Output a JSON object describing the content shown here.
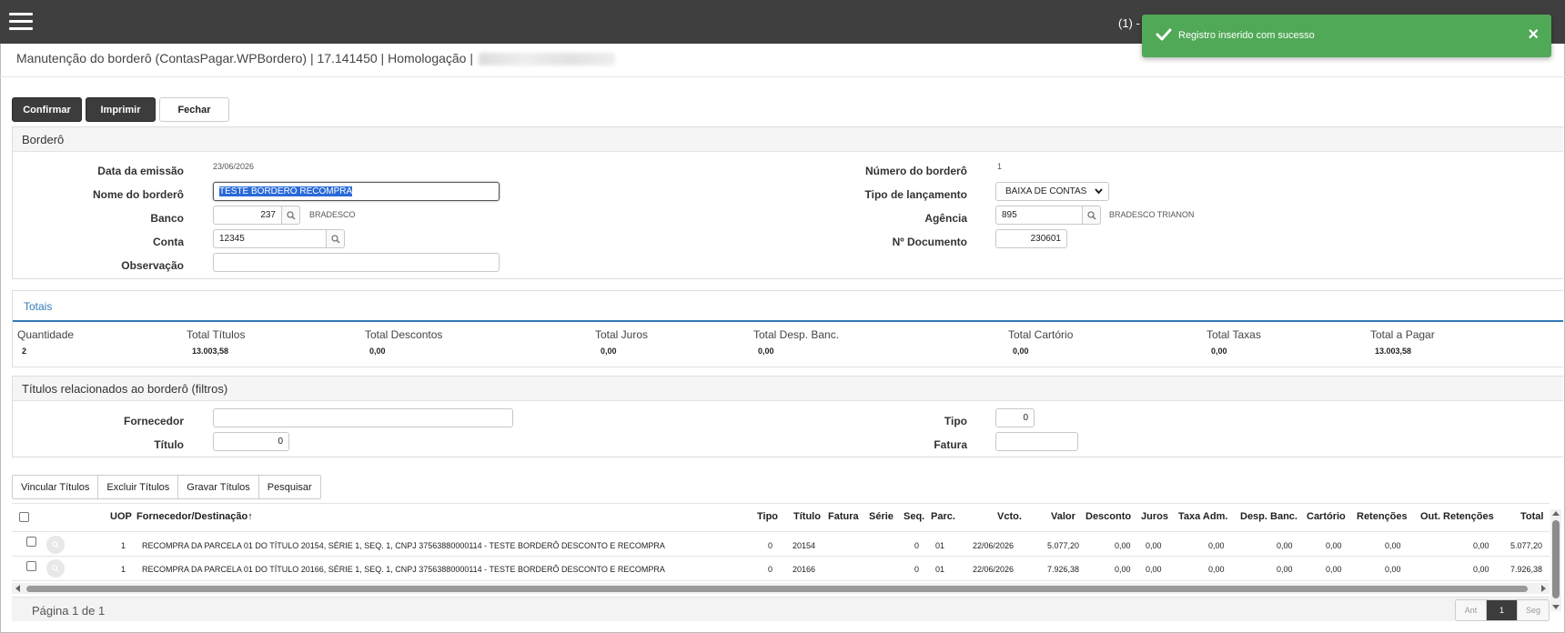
{
  "topbar": {
    "counter": "(1) -"
  },
  "toast": {
    "message": "Registro inserido com sucesso",
    "close": "×"
  },
  "page_title": "Manutenção do borderô (ContasPagar.WPBordero) | 17.141450 | Homologação | ",
  "toolbar": {
    "confirm": "Confirmar",
    "print": "Imprimir",
    "close": "Fechar"
  },
  "bordero": {
    "header": "Borderô",
    "data_emissao_label": "Data da emissão",
    "data_emissao": "23/06/2026",
    "nome_label": "Nome do borderô",
    "nome": "TESTE BORDERÔ RECOMPRA",
    "banco_label": "Banco",
    "banco": "237",
    "banco_nome": "BRADESCO",
    "conta_label": "Conta",
    "conta": "12345",
    "observacao_label": "Observação",
    "observacao": "",
    "numero_label": "Número do borderô",
    "numero": "1",
    "tipo_lanc_label": "Tipo de lançamento",
    "tipo_lanc": "BAIXA DE CONTAS",
    "agencia_label": "Agência",
    "agencia": "895",
    "agencia_nome": "BRADESCO TRIANON",
    "documento_label": "Nº Documento",
    "documento": "230601"
  },
  "totais": {
    "header": "Totais",
    "items": [
      {
        "label": "Quantidade",
        "value": "2"
      },
      {
        "label": "Total Títulos",
        "value": "13.003,58"
      },
      {
        "label": "Total Descontos",
        "value": "0,00"
      },
      {
        "label": "Total Juros",
        "value": "0,00"
      },
      {
        "label": "Total Desp. Banc.",
        "value": "0,00"
      },
      {
        "label": "Total Cartório",
        "value": "0,00"
      },
      {
        "label": "Total Taxas",
        "value": "0,00"
      },
      {
        "label": "Total a Pagar",
        "value": "13.003,58"
      }
    ]
  },
  "filtros": {
    "header": "Títulos relacionados ao borderô (filtros)",
    "fornecedor_label": "Fornecedor",
    "fornecedor": "",
    "titulo_label": "Título",
    "titulo": "0",
    "tipo_label": "Tipo",
    "tipo": "0",
    "fatura_label": "Fatura",
    "fatura": ""
  },
  "actions": {
    "vincular": "Vincular Títulos",
    "excluir": "Excluir Títulos",
    "gravar": "Gravar Títulos",
    "pesquisar": "Pesquisar"
  },
  "grid": {
    "columns": [
      "UOP",
      "Fornecedor/Destinação",
      "Tipo",
      "Título",
      "Fatura",
      "Série",
      "Seq.",
      "Parc.",
      "Vcto.",
      "Valor",
      "Desconto",
      "Juros",
      "Taxa Adm.",
      "Desp. Banc.",
      "Cartório",
      "Retenções",
      "Out. Retenções",
      "Total"
    ],
    "sort_indicator": "↑",
    "rows": [
      {
        "uop": "1",
        "fornecedor": "RECOMPRA DA PARCELA 01 DO TÍTULO 20154, SÉRIE 1, SEQ. 1, CNPJ 37563880000114 - TESTE BORDERÔ DESCONTO E RECOMPRA",
        "tipo": "0",
        "titulo": "20154",
        "fatura": "",
        "serie": "",
        "seq": "0",
        "parc": "01",
        "vcto": "22/06/2026",
        "valor": "5.077,20",
        "desconto": "0,00",
        "juros": "0,00",
        "taxa": "0,00",
        "desp": "0,00",
        "cartorio": "0,00",
        "retencoes": "0,00",
        "out_ret": "0,00",
        "total": "5.077,20"
      },
      {
        "uop": "1",
        "fornecedor": "RECOMPRA DA PARCELA 01 DO TÍTULO 20166, SÉRIE 1, SEQ. 1, CNPJ 37563880000114 - TESTE BORDERÔ DESCONTO E RECOMPRA",
        "tipo": "0",
        "titulo": "20166",
        "fatura": "",
        "serie": "",
        "seq": "0",
        "parc": "01",
        "vcto": "22/06/2026",
        "valor": "7.926,38",
        "desconto": "0,00",
        "juros": "0,00",
        "taxa": "0,00",
        "desp": "0,00",
        "cartorio": "0,00",
        "retencoes": "0,00",
        "out_ret": "0,00",
        "total": "7.926,38"
      }
    ]
  },
  "pagination": {
    "label": "Página 1 de 1",
    "prev": "Ant",
    "current": "1",
    "next": "Seg"
  },
  "colors": {
    "topbar": "#3f3f3f",
    "toast": "#50a956",
    "accent": "#2a6ad8",
    "totais_header": "#337ab7"
  }
}
